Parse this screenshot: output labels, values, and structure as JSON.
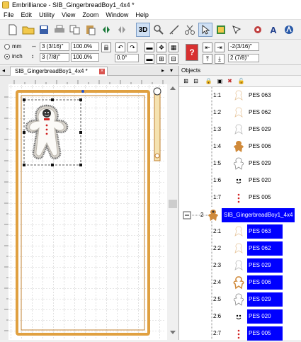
{
  "window": {
    "title": "Embrilliance - SIB_GingerbreadBoy1_4x4 *"
  },
  "menu": [
    "File",
    "Edit",
    "Utility",
    "View",
    "Zoom",
    "Window",
    "Help"
  ],
  "toolbar": {
    "view3d_label": "3D"
  },
  "props": {
    "unit_mm": "mm",
    "unit_inch": "inch",
    "width_value": "3 (3/16)\"",
    "width_pct": "100.0%",
    "height_value": "3 (7/8)\"",
    "height_pct": "100.0%",
    "rotation_value": "0.0°",
    "x_value": "-2(3/16)\"",
    "y_value": "2 (7/8)\""
  },
  "tab": {
    "label": "SIB_GingerbreadBoy1_4x4 *"
  },
  "objects": {
    "header": "Objects",
    "group_index": "2",
    "group_name": "SIB_GingerbreadBoy1_4x4",
    "group1": [
      {
        "index": "1:1",
        "name": "PES 063"
      },
      {
        "index": "1:2",
        "name": "PES 062"
      },
      {
        "index": "1:3",
        "name": "PES 029"
      },
      {
        "index": "1:4",
        "name": "PES 006"
      },
      {
        "index": "1:5",
        "name": "PES 029"
      },
      {
        "index": "1:6",
        "name": "PES 020"
      },
      {
        "index": "1:7",
        "name": "PES 005"
      }
    ],
    "group2": [
      {
        "index": "2:1",
        "name": "PES 063"
      },
      {
        "index": "2:2",
        "name": "PES 062"
      },
      {
        "index": "2:3",
        "name": "PES 029"
      },
      {
        "index": "2:4",
        "name": "PES 006"
      },
      {
        "index": "2:5",
        "name": "PES 029"
      },
      {
        "index": "2:6",
        "name": "PES 020"
      },
      {
        "index": "2:7",
        "name": "PES 005"
      }
    ]
  },
  "colors": {
    "selection_blue": "#0000ff",
    "hoop_orange": "#e0a040",
    "gingerbread_tan": "#d08a3a"
  }
}
